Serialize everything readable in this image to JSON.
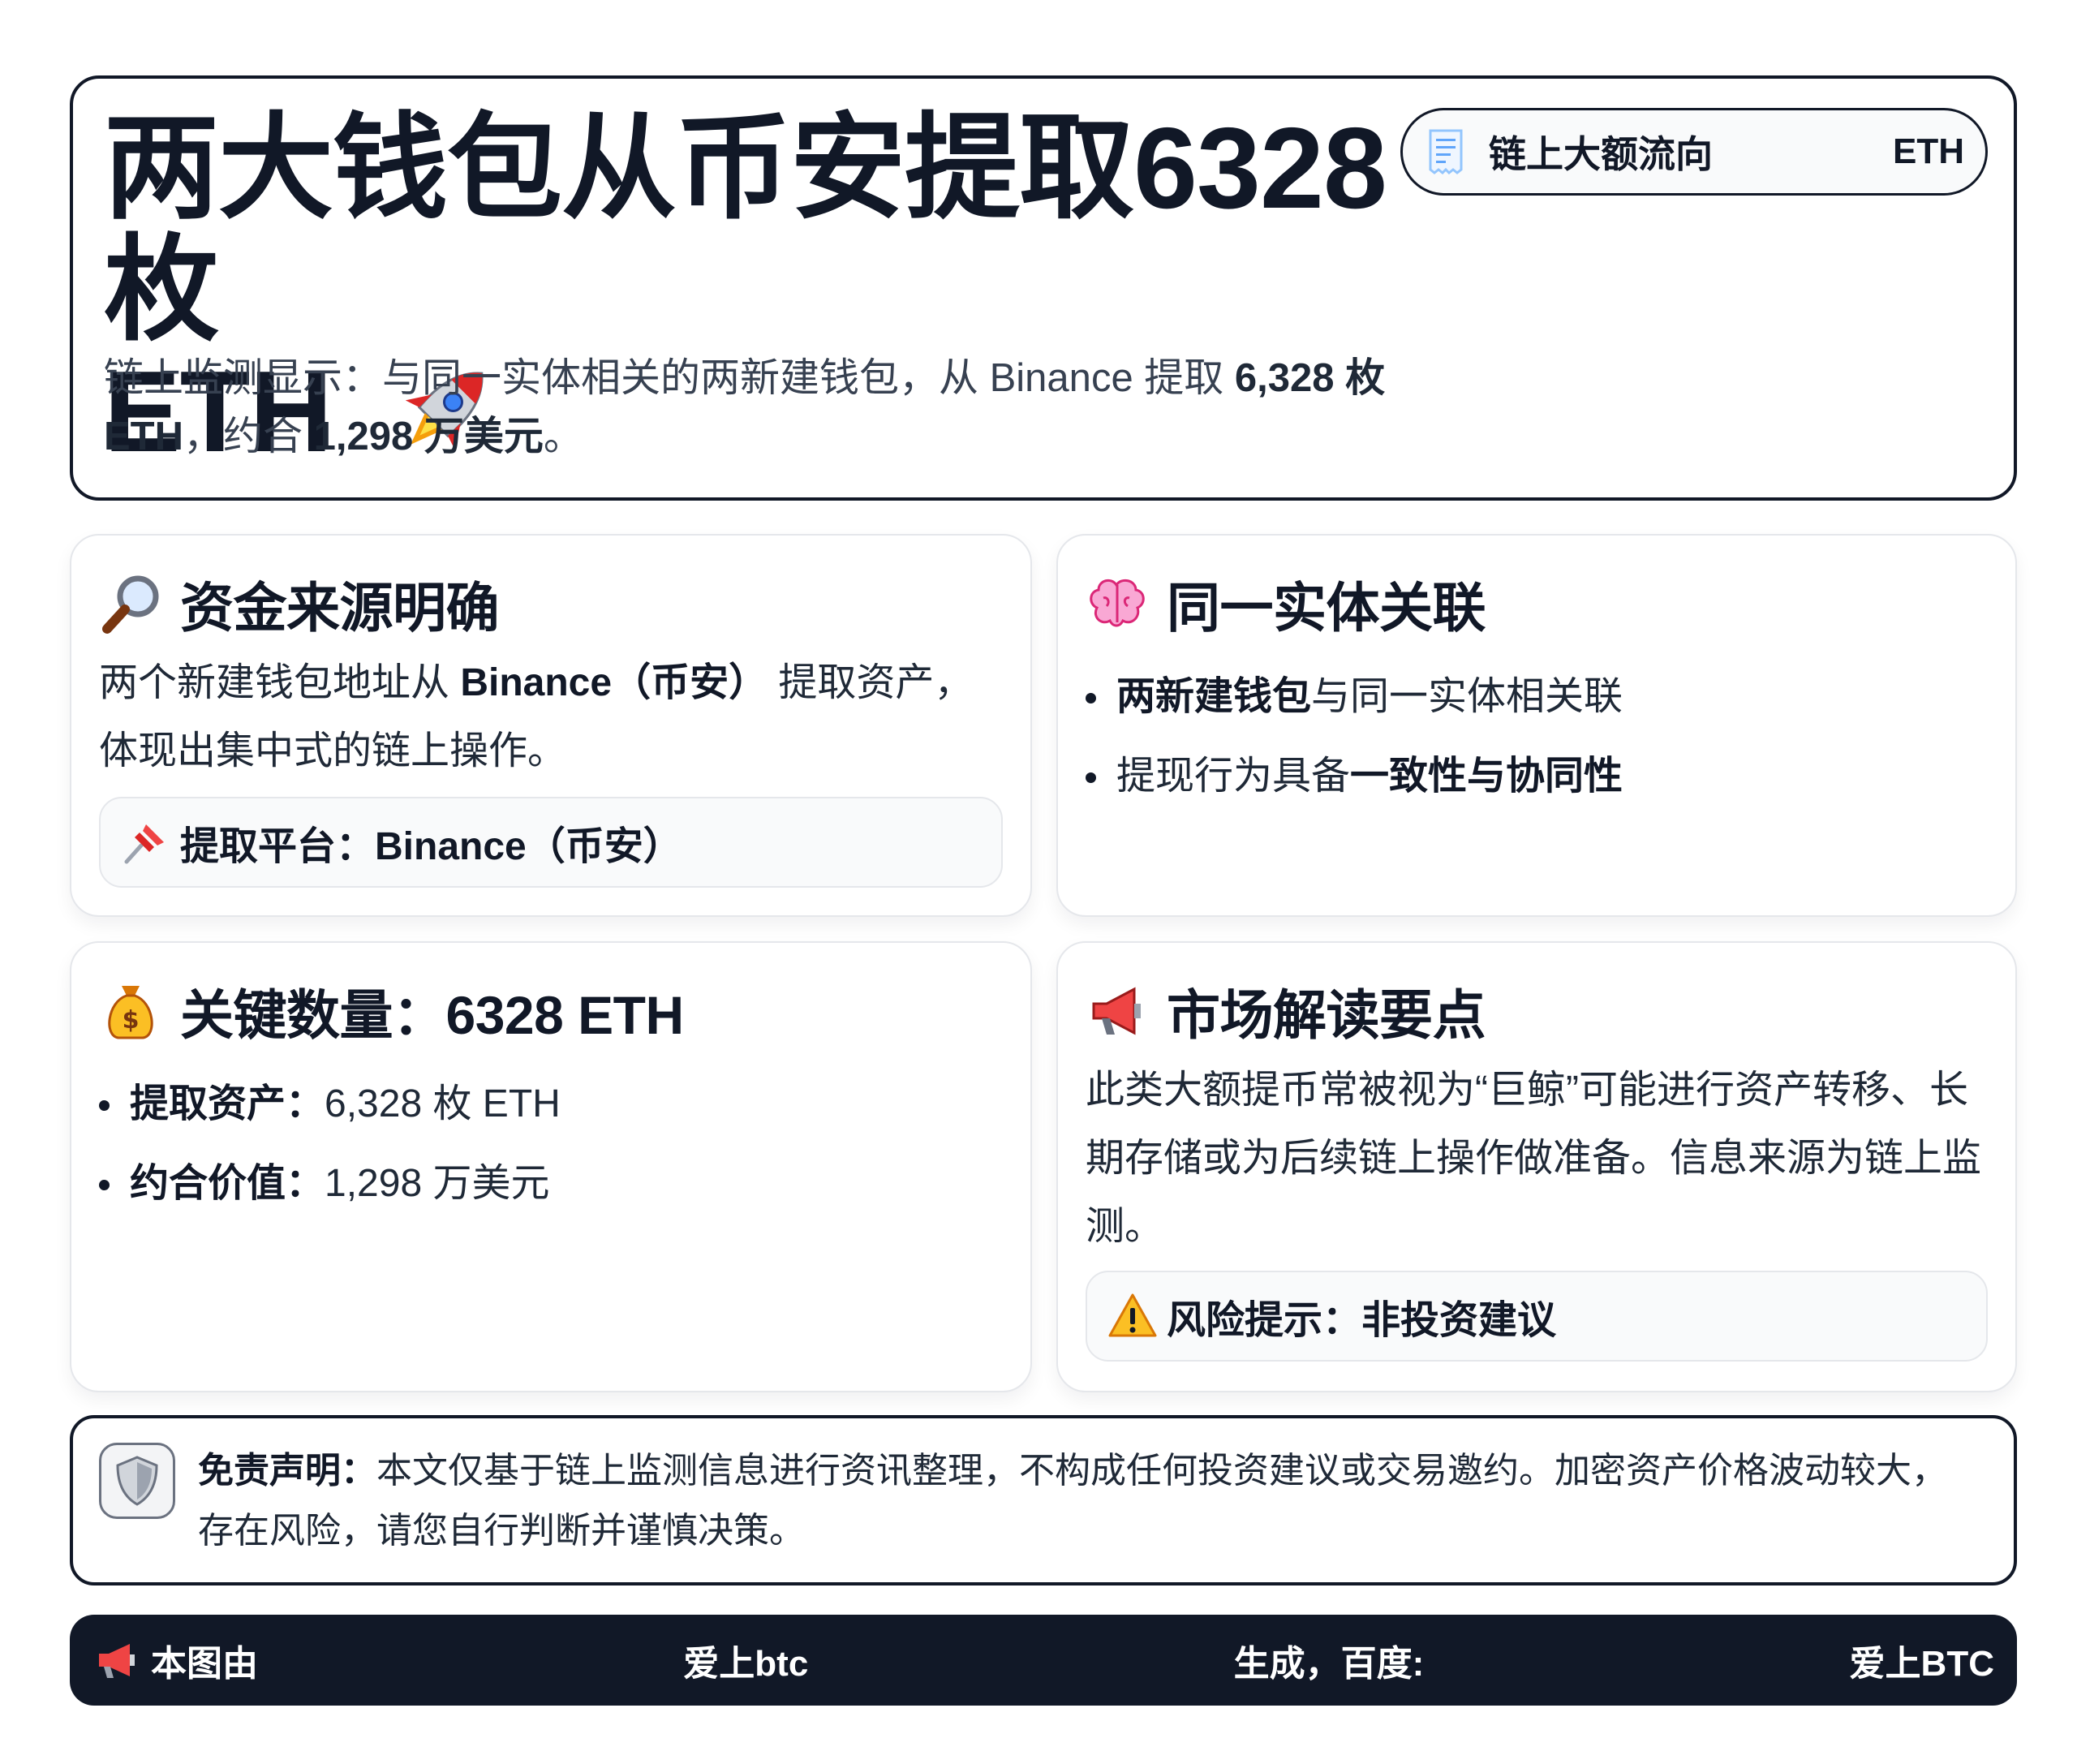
{
  "header": {
    "title_line1": "两大钱包从币安提取6328枚",
    "title_line2": "ETH",
    "subtitle_prefix": "链上监测显示：与同一实体相关的两新建钱包，从 Binance 提取 ",
    "subtitle_amount": "6,328 枚 ETH",
    "subtitle_mid": "，约合 ",
    "subtitle_value": "1,298 万美元",
    "subtitle_suffix": "。",
    "tag_label": "链上大额流向",
    "tag_value": "ETH"
  },
  "cards": {
    "source": {
      "title": "资金来源明确",
      "text_prefix": "两个新建钱包地址从 ",
      "text_bold": "Binance（币安）",
      "text_suffix": " 提取资产，体现出集中式的链上操作。",
      "pill_text": "提取平台：Binance（币安）"
    },
    "entity": {
      "title": "同一实体关联",
      "b1_bold": "两新建钱包",
      "b1_text": "与同一实体相关联",
      "b2_text": "提现行为具备",
      "b2_bold": "一致性与协同性"
    },
    "amount": {
      "title": "关键数量：6328 ETH",
      "b1_label": "提取资产：",
      "b1_value": "6,328 枚 ETH",
      "b2_label": "约合价值：",
      "b2_value": "1,298 万美元"
    },
    "market": {
      "title": "市场解读要点",
      "text": "此类大额提币常被视为“巨鲸”可能进行资产转移、长期存储或为后续链上操作做准备。信息来源为链上监测。",
      "pill_text": "风险提示：非投资建议"
    }
  },
  "disclaimer": {
    "label": "免责声明：",
    "text": "本文仅基于链上监测信息进行资讯整理，不构成任何投资建议或交易邀约。加密资产价格波动较大，存在风险，请您自行判断并谨慎决策。"
  },
  "footer": {
    "seg1": "本图由",
    "seg2": "爱上btc",
    "seg3": "生成，百度:",
    "seg4": "爱上BTC"
  },
  "icons": {
    "hero": "rocket-icon",
    "tag": "receipt-icon",
    "source": "magnifier-icon",
    "source_pill": "pushpin-icon",
    "entity": "brain-icon",
    "amount": "money-bag-icon",
    "market": "megaphone-icon",
    "market_pill": "warning-icon",
    "disclaimer": "shield-icon",
    "footer": "megaphone-icon"
  },
  "colors": {
    "text_dark": "#111827",
    "footer_bg": "#111827",
    "card_border": "#e5e7eb"
  }
}
